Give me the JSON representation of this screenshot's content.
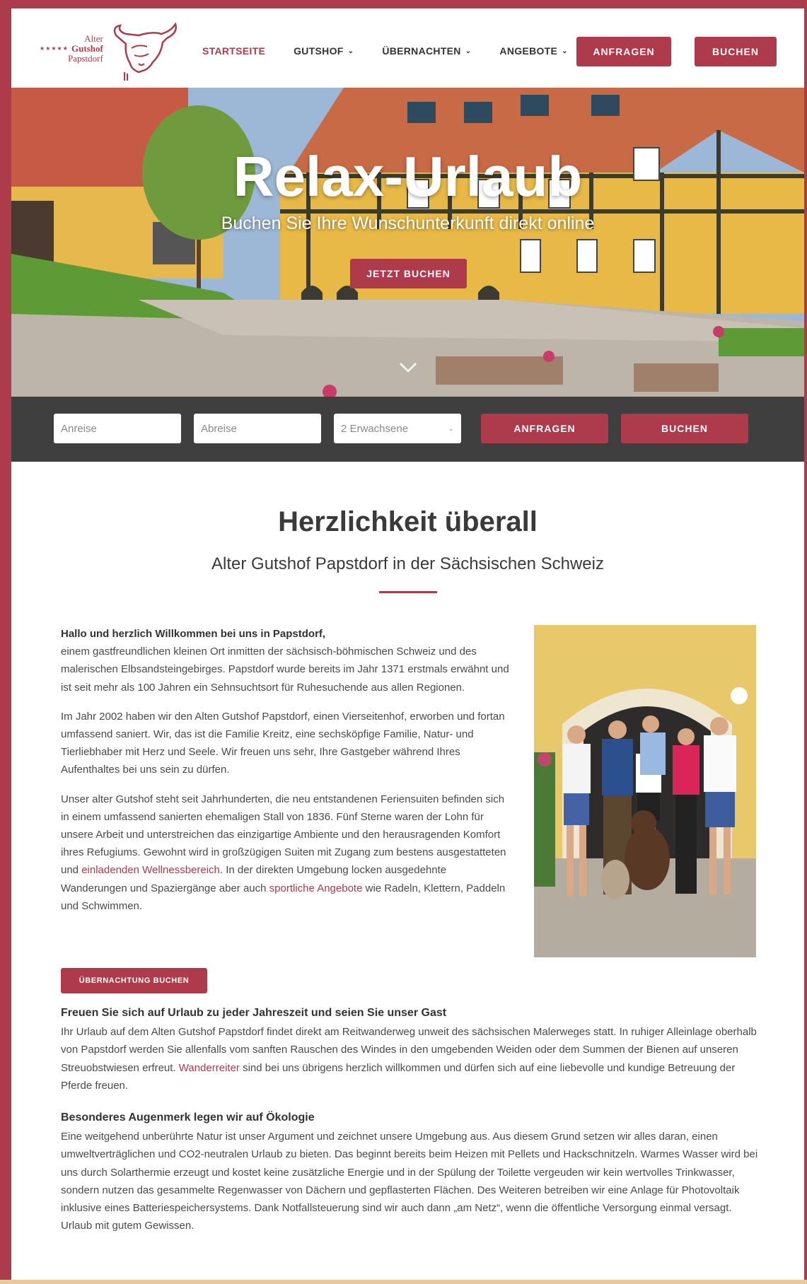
{
  "colors": {
    "accent": "#ad3b4b",
    "bar": "#3f3f3f",
    "text": "#3a3a3a"
  },
  "logo": {
    "line1": "Alter",
    "line2": "Gutshof",
    "line3": "Papstdorf",
    "stars": "★★★★★"
  },
  "nav": {
    "items": [
      {
        "label": "STARTSEITE",
        "dropdown": false
      },
      {
        "label": "GUTSHOF",
        "dropdown": true
      },
      {
        "label": "ÜBERNACHTEN",
        "dropdown": true
      },
      {
        "label": "ANGEBOTE",
        "dropdown": true
      }
    ],
    "anfragen": "ANFRAGEN",
    "buchen": "BUCHEN"
  },
  "hero": {
    "title": "Relax-Urlaub",
    "subtitle": "Buchen Sie Ihre Wunschunterkunft direkt online",
    "button": "JETZT BUCHEN"
  },
  "booking": {
    "arrival_placeholder": "Anreise",
    "departure_placeholder": "Abreise",
    "guests": "2 Erwachsene",
    "anfragen": "ANFRAGEN",
    "buchen": "BUCHEN"
  },
  "main": {
    "heading": "Herzlichkeit überall",
    "subheading": "Alter Gutshof Papstdorf in der Sächsischen Schweiz",
    "intro_bold": "Hallo und herzlich Willkommen bei uns in Papstdorf,",
    "intro_p1": "einem gastfreundlichen kleinen Ort inmitten der sächsisch-böhmischen Schweiz und des malerischen Elbsandsteingebirges. Papstdorf wurde bereits im Jahr 1371 erstmals erwähnt und ist seit mehr als 100 Jahren ein Sehnsuchtsort für Ruhesuchende aus allen Regionen.",
    "intro_p2": "Im Jahr 2002 haben wir den Alten Gutshof Papstdorf, einen Vierseitenhof, erworben und fortan umfassend saniert. Wir, das ist die Familie Kreitz, eine sechsköpfige Familie, Natur- und Tierliebhaber mit Herz und Seele. Wir freuen uns sehr, Ihre Gastgeber während Ihres Aufenthaltes bei uns sein zu dürfen.",
    "intro_p3a": "Unser alter Gutshof steht seit Jahrhunderten, die neu entstandenen Feriensuiten befinden sich in einem umfassend sanierten ehemaligen Stall von 1836. Fünf Sterne waren der Lohn für unsere Arbeit und unterstreichen das einzigartige Ambiente und den herausragenden Komfort ihres Refugiums. Gewohnt wird in großzügigen Suiten mit Zugang zum bestens ausgestatteten und ",
    "intro_link1": "einladenden Wellnessbereich",
    "intro_p3b": ". In der direkten Umgebung locken ausgedehnte Wanderungen und Spaziergänge aber auch ",
    "intro_link2": "sportliche Angebote",
    "intro_p3c": " wie Radeln, Klettern, Paddeln und Schwimmen.",
    "cta": "ÜBERNACHTUNG BUCHEN",
    "sec1_title": "Freuen Sie sich auf Urlaub zu jeder Jahreszeit und seien Sie unser Gast",
    "sec1_a": "Ihr Urlaub auf dem Alten Gutshof Papstdorf findet direkt am Reitwanderweg unweit des sächsischen Malerweges statt. In ruhiger Alleinlage oberhalb von Papstdorf werden Sie allenfalls vom sanften Rauschen des Windes in den umgebenden Weiden oder dem Summen der Bienen auf unseren Streuobstwiesen erfreut. ",
    "sec1_link": "Wanderreiter",
    "sec1_b": " sind bei uns übrigens herzlich willkommen und dürfen sich auf eine liebevolle und kundige Betreuung der Pferde freuen.",
    "sec2_title": "Besonderes Augenmerk legen wir auf Ökologie",
    "sec2_text": "Eine weitgehend unberührte Natur ist unser Argument und zeichnet unsere Umgebung aus. Aus diesem Grund setzen wir alles daran, einen umweltverträglichen und CO2-neutralen Urlaub zu bieten. Das beginnt bereits beim Heizen mit Pellets und Hackschnitzeln. Warmes Wasser wird bei uns durch Solarthermie erzeugt und kostet keine zusätzliche Energie und in der Spülung der Toilette vergeuden wir kein wertvolles Trinkwasser, sondern nutzen das gesammelte Regenwasser von Dächern und gepflasterten Flächen. Des Weiteren betreiben wir eine Anlage für Photovoltaik inklusive eines Batteriespeichersystems. Dank Notfallsteuerung sind wir auch dann „am Netz“, wenn die öffentliche Versorgung einmal versagt. Urlaub mit gutem Gewissen."
  }
}
